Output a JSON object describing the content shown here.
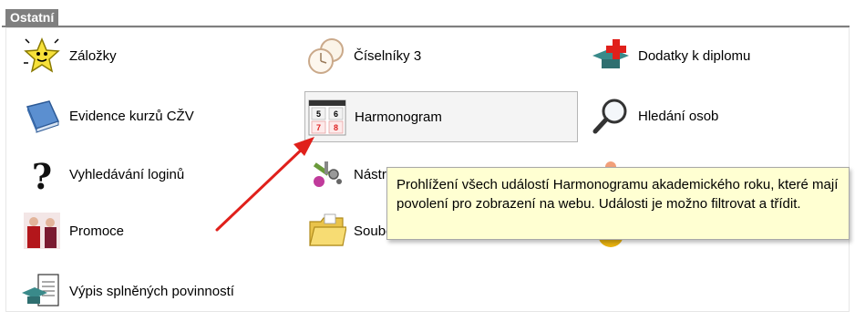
{
  "section": {
    "title": "Ostatní"
  },
  "items": [
    {
      "label": "Záložky",
      "icon": "star-bookmark-icon"
    },
    {
      "label": "Číselníky 3",
      "icon": "clock-icon"
    },
    {
      "label": "Dodatky k diplomu",
      "icon": "diploma-cap-icon"
    },
    {
      "label": "Evidence kurzů CŽV",
      "icon": "book-icon"
    },
    {
      "label": "Harmonogram",
      "icon": "calendar-icon"
    },
    {
      "label": "Hledání osob",
      "icon": "magnifier-icon"
    },
    {
      "label": "Vyhledávání loginů",
      "icon": "question-mark-icon"
    },
    {
      "label": "Nástroje",
      "icon": "tools-icon"
    },
    {
      "label": "",
      "icon": "figure-icon"
    },
    {
      "label": "Promoce",
      "icon": "graduation-people-icon"
    },
    {
      "label": "Soubory",
      "icon": "folder-icon"
    },
    {
      "label": "",
      "icon": "flower-icon"
    },
    {
      "label": "Výpis splněných povinností",
      "icon": "document-cap-icon"
    }
  ],
  "tooltip": {
    "text": "Prohlížení všech událostí Harmonogramu akademického roku, které mají povolení pro zobrazení na webu. Události je možno filtrovat a třídit."
  },
  "colors": {
    "header_bg": "#7f7f7f",
    "tooltip_bg": "#ffffd2",
    "arrow": "#e0201b"
  }
}
